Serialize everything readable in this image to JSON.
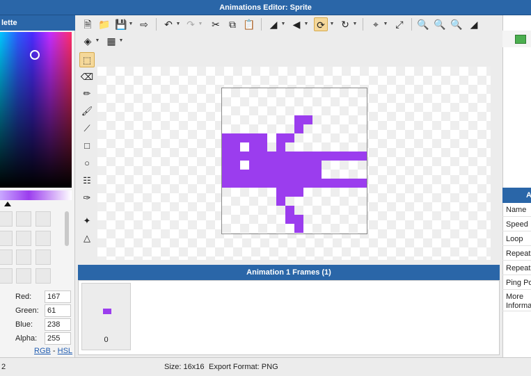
{
  "window": {
    "title": "Animations Editor: Sprite"
  },
  "palette": {
    "header": "lette",
    "red_label": "Red:",
    "red": "167",
    "green_label": "Green:",
    "green": "61",
    "blue_label": "Blue:",
    "blue": "238",
    "alpha_label": "Alpha:",
    "alpha": "255",
    "mode_rgb": "RGB",
    "mode_sep": "-",
    "mode_hsl": "HSL"
  },
  "toolbar": {
    "icons": [
      "new-file-icon",
      "open-folder-icon",
      "save-icon",
      "export-icon",
      "undo-icon",
      "redo-icon",
      "cut-icon",
      "copy-icon",
      "paste-icon",
      "flip-horizontal-icon",
      "flip-vertical-icon",
      "rotate-icon",
      "rotate-icon-2",
      "crop-icon",
      "resize-icon",
      "zoom-in-icon",
      "zoom-out-icon",
      "zoom-fit-icon",
      "background-toggle-icon",
      "layers-icon",
      "grid-icon"
    ]
  },
  "tools": [
    "selection",
    "eraser",
    "pencil",
    "brush",
    "line",
    "rectangle",
    "ellipse",
    "fill",
    "eyedropper",
    "origin",
    "transform"
  ],
  "sprite": {
    "fill_color": "#9b3dee",
    "grid_size": 16,
    "pixels": [
      [
        8,
        3
      ],
      [
        9,
        3
      ],
      [
        8,
        4
      ],
      [
        6,
        5
      ],
      [
        7,
        5
      ],
      [
        6,
        6
      ],
      [
        0,
        5
      ],
      [
        1,
        5
      ],
      [
        2,
        5
      ],
      [
        3,
        5
      ],
      [
        4,
        5
      ],
      [
        0,
        6
      ],
      [
        1,
        6
      ],
      [
        3,
        6
      ],
      [
        4,
        6
      ],
      [
        0,
        7
      ],
      [
        1,
        7
      ],
      [
        2,
        7
      ],
      [
        3,
        7
      ],
      [
        4,
        7
      ],
      [
        5,
        7
      ],
      [
        6,
        7
      ],
      [
        7,
        7
      ],
      [
        8,
        7
      ],
      [
        9,
        7
      ],
      [
        10,
        7
      ],
      [
        11,
        7
      ],
      [
        12,
        7
      ],
      [
        13,
        7
      ],
      [
        14,
        7
      ],
      [
        15,
        7
      ],
      [
        0,
        8
      ],
      [
        1,
        8
      ],
      [
        3,
        8
      ],
      [
        4,
        8
      ],
      [
        5,
        8
      ],
      [
        6,
        8
      ],
      [
        7,
        8
      ],
      [
        8,
        8
      ],
      [
        9,
        8
      ],
      [
        10,
        8
      ],
      [
        0,
        9
      ],
      [
        1,
        9
      ],
      [
        2,
        9
      ],
      [
        3,
        9
      ],
      [
        4,
        9
      ],
      [
        5,
        9
      ],
      [
        6,
        9
      ],
      [
        7,
        9
      ],
      [
        8,
        9
      ],
      [
        9,
        9
      ],
      [
        10,
        9
      ],
      [
        0,
        10
      ],
      [
        1,
        10
      ],
      [
        2,
        10
      ],
      [
        3,
        10
      ],
      [
        4,
        10
      ],
      [
        5,
        10
      ],
      [
        6,
        10
      ],
      [
        7,
        10
      ],
      [
        8,
        10
      ],
      [
        9,
        10
      ],
      [
        10,
        10
      ],
      [
        11,
        10
      ],
      [
        12,
        10
      ],
      [
        13,
        10
      ],
      [
        14,
        10
      ],
      [
        15,
        10
      ],
      [
        6,
        11
      ],
      [
        7,
        11
      ],
      [
        8,
        11
      ],
      [
        6,
        12
      ],
      [
        7,
        13
      ],
      [
        7,
        14
      ],
      [
        8,
        14
      ],
      [
        8,
        15
      ]
    ]
  },
  "frames": {
    "header": "Animation 1 Frames (1)",
    "frame_number": "0"
  },
  "right_panel": {
    "header": "Ai",
    "props": [
      "Name",
      "Speed",
      "Loop",
      "Repeat",
      "Repeat",
      "Ping Po",
      "More Informa"
    ]
  },
  "status": {
    "left": "2",
    "size": "Size: 16x16",
    "export": "Export Format: PNG"
  }
}
